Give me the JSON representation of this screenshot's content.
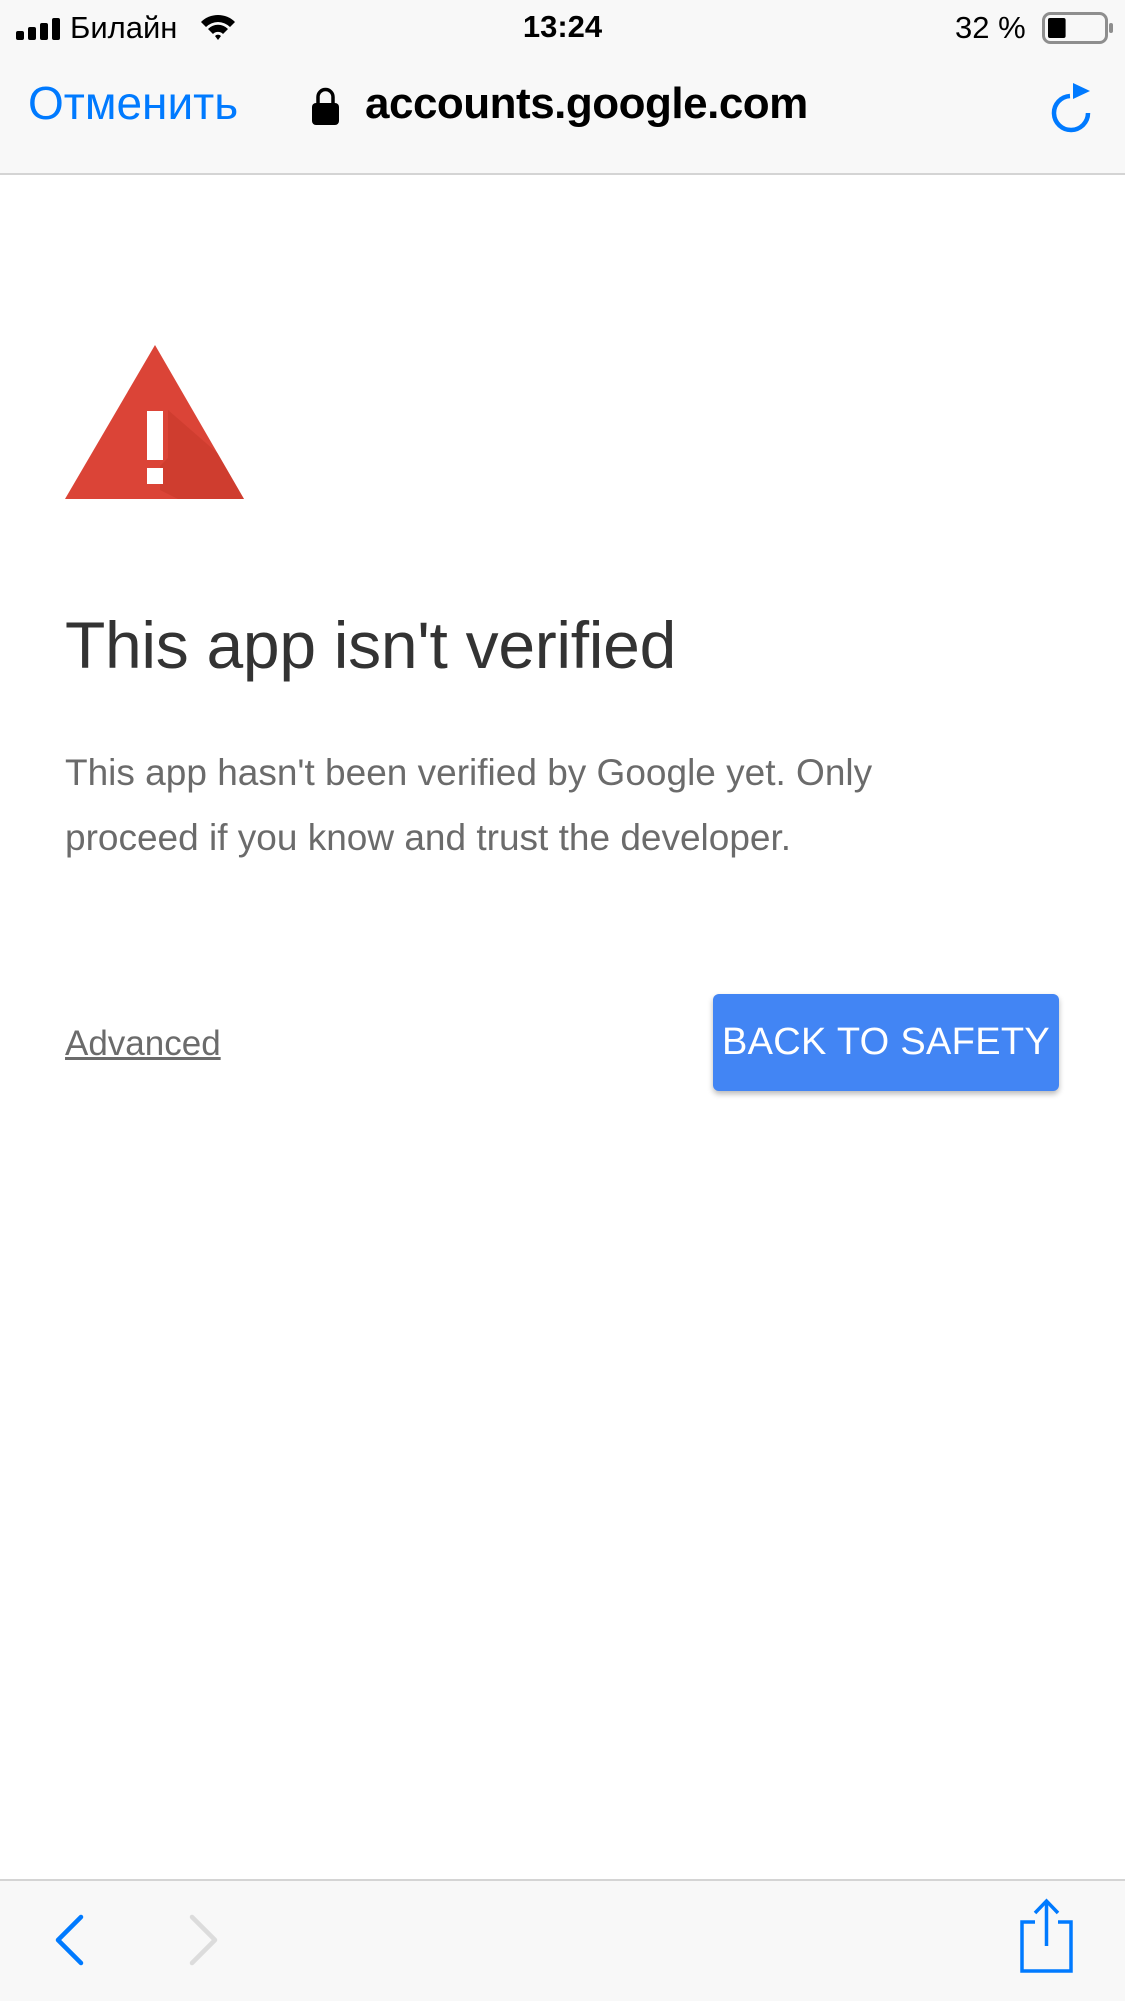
{
  "status_bar": {
    "carrier": "Билайн",
    "time": "13:24",
    "battery_percent_label": "32 %",
    "battery_level": 0.32,
    "signal_icon": "cellular-signal-icon",
    "wifi_icon": "wifi-icon",
    "battery_icon": "battery-icon"
  },
  "nav_bar": {
    "cancel_label": "Отменить",
    "url": "accounts.google.com",
    "lock_icon": "lock-icon",
    "reload_icon": "reload-icon"
  },
  "page": {
    "warning_icon": "warning-triangle-icon",
    "title": "This app isn't verified",
    "description": "This app hasn't been verified by Google yet. Only proceed if you know and trust the developer.",
    "advanced_link": "Advanced",
    "back_to_safety_button": "BACK TO SAFETY"
  },
  "toolbar": {
    "back_icon": "chevron-left-icon",
    "forward_icon": "chevron-right-icon",
    "share_icon": "share-icon"
  },
  "colors": {
    "ios_accent": "#007aff",
    "google_blue": "#4285f4",
    "warning_red": "#db4437",
    "title_text": "#333333",
    "body_text": "#6b6b6b"
  }
}
